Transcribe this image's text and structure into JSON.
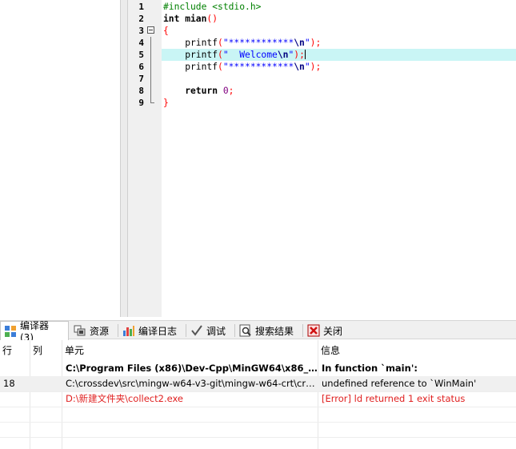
{
  "editor": {
    "lines": [
      {
        "num": "1",
        "tokens": [
          {
            "t": "#include <stdio.h>",
            "c": "pre"
          }
        ]
      },
      {
        "num": "2",
        "tokens": [
          {
            "t": "int",
            "c": "kw"
          },
          {
            "t": " mian",
            "c": "kw"
          },
          {
            "t": "()",
            "c": "sym"
          }
        ]
      },
      {
        "num": "3",
        "tokens": [
          {
            "t": "{",
            "c": "sym"
          }
        ]
      },
      {
        "num": "4",
        "tokens": [
          {
            "t": "    printf",
            "c": "plain"
          },
          {
            "t": "(",
            "c": "sym"
          },
          {
            "t": "\"************",
            "c": "str"
          },
          {
            "t": "\\n",
            "c": "esc"
          },
          {
            "t": "\"",
            "c": "str"
          },
          {
            "t": ");",
            "c": "sym"
          }
        ]
      },
      {
        "num": "5",
        "tokens": [
          {
            "t": "    printf",
            "c": "plain"
          },
          {
            "t": "(",
            "c": "sym"
          },
          {
            "t": "\"  Welcome",
            "c": "str"
          },
          {
            "t": "\\n",
            "c": "esc"
          },
          {
            "t": "\"",
            "c": "str"
          },
          {
            "t": ");",
            "c": "sym"
          }
        ]
      },
      {
        "num": "6",
        "tokens": [
          {
            "t": "    printf",
            "c": "plain"
          },
          {
            "t": "(",
            "c": "sym"
          },
          {
            "t": "\"************",
            "c": "str"
          },
          {
            "t": "\\n",
            "c": "esc"
          },
          {
            "t": "\"",
            "c": "str"
          },
          {
            "t": ");",
            "c": "sym"
          }
        ]
      },
      {
        "num": "7",
        "tokens": []
      },
      {
        "num": "8",
        "tokens": [
          {
            "t": "    return",
            "c": "kw"
          },
          {
            "t": " ",
            "c": "plain"
          },
          {
            "t": "0",
            "c": "num"
          },
          {
            "t": ";",
            "c": "sym"
          }
        ]
      },
      {
        "num": "9",
        "tokens": [
          {
            "t": "}",
            "c": "sym"
          }
        ]
      }
    ],
    "highlighted_line": 5
  },
  "tabs": [
    {
      "label": "编译器 (3)",
      "icon": "compiler-grid-icon",
      "active": true
    },
    {
      "label": "资源",
      "icon": "resources-icon",
      "active": false
    },
    {
      "label": "编译日志",
      "icon": "compile-log-chart-icon",
      "active": false
    },
    {
      "label": "调试",
      "icon": "debug-check-icon",
      "active": false
    },
    {
      "label": "搜索结果",
      "icon": "search-results-icon",
      "active": false
    },
    {
      "label": "关闭",
      "icon": "close-red-x-icon",
      "active": false
    }
  ],
  "messages": {
    "columns": [
      "行",
      "列",
      "单元",
      "信息"
    ],
    "rows": [
      {
        "line": "",
        "col": "",
        "unit": "C:\\Program Files (x86)\\Dev-Cpp\\MinGW64\\x86_64-w...",
        "message": "In function `main':",
        "style": "bold"
      },
      {
        "line": "18",
        "col": "",
        "unit": "C:\\crossdev\\src\\mingw-w64-v3-git\\mingw-w64-crt\\crt\\...",
        "message": "undefined reference to `WinMain'",
        "style": "normal"
      },
      {
        "line": "",
        "col": "",
        "unit": "D:\\新建文件夹\\collect2.exe",
        "message": "[Error] ld returned 1 exit status",
        "style": "error"
      }
    ]
  },
  "colors": {
    "highlight_line": "#c9f5f5",
    "preprocessor": "#008000",
    "string": "#0000ff",
    "symbol": "#ff0000",
    "error_text": "#e02020"
  }
}
